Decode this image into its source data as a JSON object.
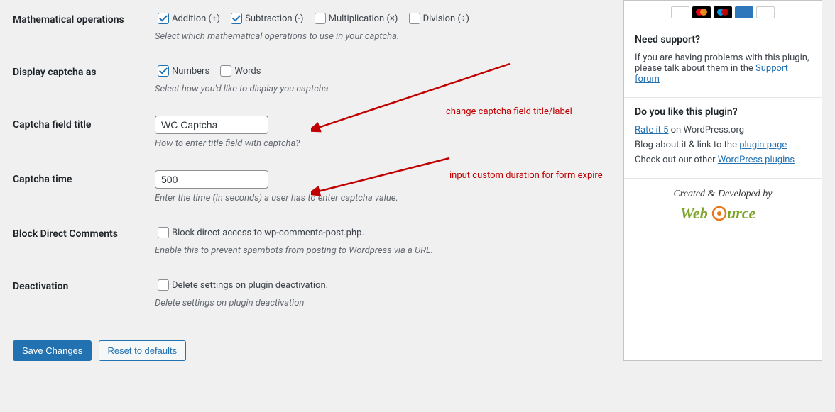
{
  "fields": {
    "math_ops": {
      "label": "Mathematical operations",
      "options": {
        "addition": "Addition (+)",
        "subtraction": "Subtraction (-)",
        "multiplication": "Multiplication (×)",
        "division": "Division (÷)"
      },
      "description": "Select which mathematical operations to use in your captcha."
    },
    "display_as": {
      "label": "Display captcha as",
      "options": {
        "numbers": "Numbers",
        "words": "Words"
      },
      "description": "Select how you'd like to display you captcha."
    },
    "field_title": {
      "label": "Captcha field title",
      "value": "WC Captcha",
      "description": "How to enter title field with captcha?"
    },
    "captcha_time": {
      "label": "Captcha time",
      "value": "500",
      "description": "Enter the time (in seconds) a user has to enter captcha value."
    },
    "block_direct": {
      "label": "Block Direct Comments",
      "option": "Block direct access to wp-comments-post.php.",
      "description": "Enable this to prevent spambots from posting to Wordpress via a URL."
    },
    "deactivation": {
      "label": "Deactivation",
      "option": "Delete settings on plugin deactivation.",
      "description": "Delete settings on plugin deactivation"
    }
  },
  "buttons": {
    "save": "Save Changes",
    "reset": "Reset to defaults"
  },
  "sidebar": {
    "support": {
      "heading": "Need support?",
      "text_before": "If you are having problems with this plugin, please talk about them in the ",
      "link": "Support forum"
    },
    "like": {
      "heading": "Do you like this plugin?",
      "rate_link": "Rate it 5",
      "rate_after": " on WordPress.org",
      "blog_before": "Blog about it & link to the ",
      "blog_link": "plugin page",
      "other_before": "Check out our other ",
      "other_link": "WordPress plugins"
    },
    "created": "Created & Developed by"
  },
  "annotations": {
    "title": "change captcha field title/label",
    "time": "input custom duration for form expire"
  }
}
